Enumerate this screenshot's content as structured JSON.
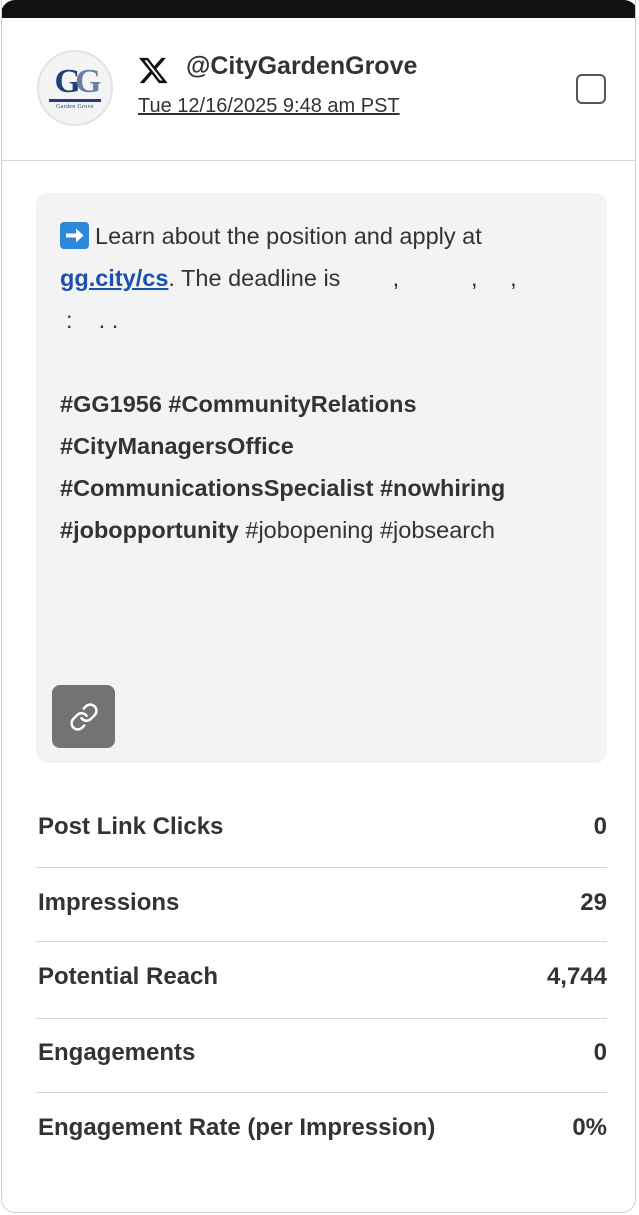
{
  "account": {
    "handle": "@CityGardenGrove",
    "timestamp": "Tue 12/16/2025 9:48 am PST",
    "avatar_text": "G",
    "avatar_subtext": "Garden Grove",
    "network_icon": "x-logo-icon"
  },
  "post": {
    "line1_text": "Learn about the position and apply at",
    "link_text": "gg.city/cs",
    "line2_rest": ". The deadline is        ,           ,     ,",
    "line3": ":    . .",
    "hashtags_bold_1": "#GG1956 #CommunityRelations",
    "hashtags_bold_2": "#CityManagersOffice",
    "hashtags_bold_3": "#CommunicationsSpecialist #nowhiring",
    "hashtag_bold_4": "#jobopportunity",
    "hashtags_plain": " #jobopening #jobsearch",
    "arrow_icon": "right-arrow-emoji-icon",
    "link_button_icon": "link-icon"
  },
  "stats": [
    {
      "label": "Post Link Clicks",
      "value": "0"
    },
    {
      "label": "Impressions",
      "value": "29"
    },
    {
      "label": "Potential Reach",
      "value": "4,744"
    },
    {
      "label": "Engagements",
      "value": "0"
    },
    {
      "label": "Engagement Rate (per Impression)",
      "value": "0%"
    }
  ],
  "colors": {
    "link": "#1b50b0",
    "post_bg": "#f2f3f2",
    "link_button_bg": "#737373",
    "arrow_emoji_bg": "#2e87d8"
  }
}
